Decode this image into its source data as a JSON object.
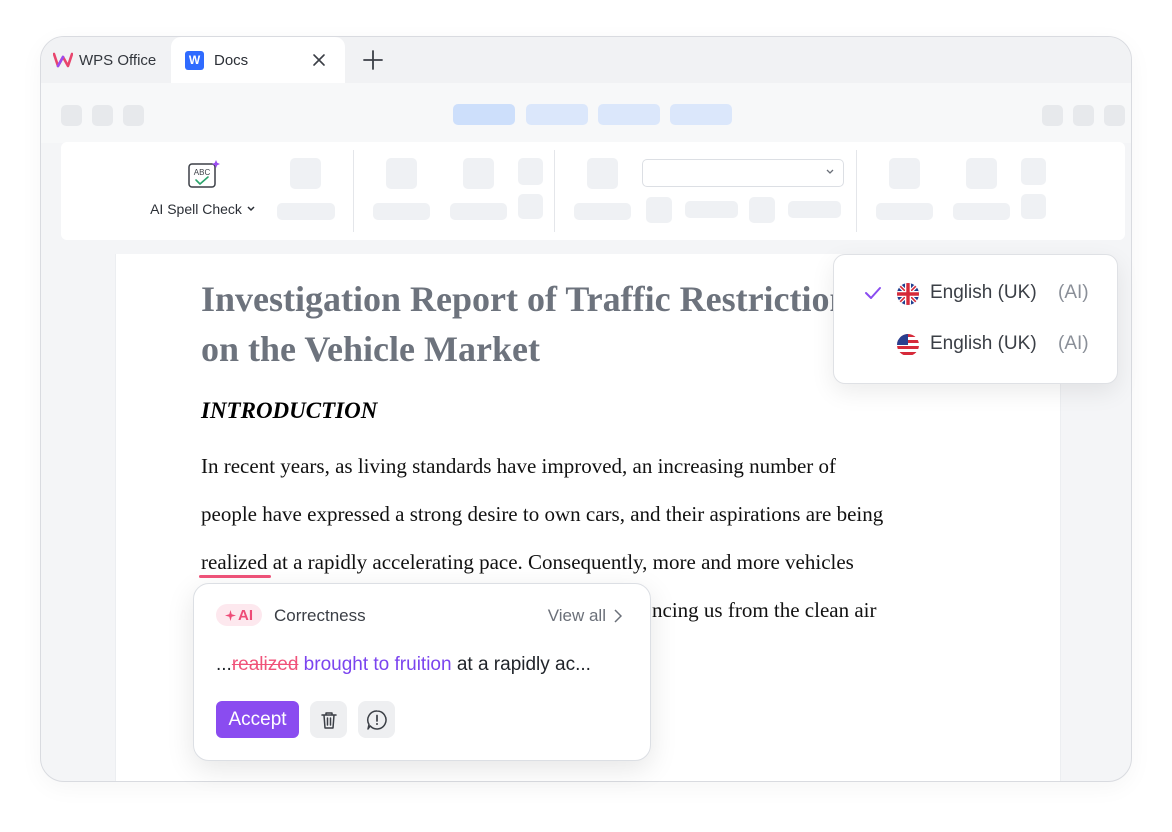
{
  "tabs": {
    "app_label": "WPS Office",
    "doc_tab_badge": "W",
    "doc_tab_label": "Docs"
  },
  "toolbar": {
    "spell_check_label": "AI Spell Check",
    "spell_icon_text": "ABC"
  },
  "document": {
    "title_line1": "Investigation Report of Traffic Restriction",
    "title_line2": "on the Vehicle Market",
    "heading": "INTRODUCTION",
    "lines": [
      "In recent years, as living standards have improved, an increasing number of",
      "people have expressed a strong desire to own cars, and their aspirations are being",
      " at a rapidly accelerating pace. Consequently, more and more vehicles",
      "ncing us from the clean air"
    ],
    "flagged_word": "realized"
  },
  "language_menu": {
    "items": [
      {
        "name": "English (UK)",
        "tag": "(AI)",
        "selected": true,
        "flag": "uk-flag"
      },
      {
        "name": "English (UK)",
        "tag": "(AI)",
        "selected": false,
        "flag": "us-flag"
      }
    ]
  },
  "suggestion": {
    "badge": "AI",
    "category": "Correctness",
    "view_all": "View all",
    "prefix": "...",
    "original": "realized",
    "replacement": "brought to fruition",
    "suffix": " at a rapidly ac...",
    "accept_label": "Accept"
  },
  "colors": {
    "accent": "#8a4cf0",
    "error": "#f0537a",
    "replacement": "#7b44ef",
    "docs_blue": "#2f6bff"
  }
}
